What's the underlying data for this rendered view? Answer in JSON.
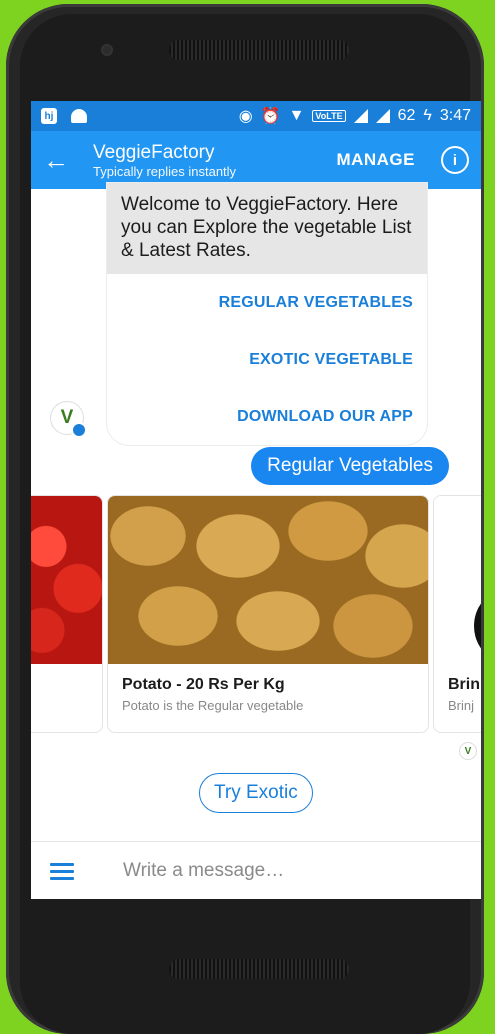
{
  "status_bar": {
    "app_icons": [
      "hj",
      "android-icon"
    ],
    "network": "VoLTE",
    "battery": "62",
    "time": "3:47"
  },
  "header": {
    "title": "VeggieFactory",
    "subtitle": "Typically replies instantly",
    "manage_label": "MANAGE",
    "info_label": "i"
  },
  "chat": {
    "card_text": "Welcome to VeggieFactory. Here you can Explore the vegetable List & Latest Rates.",
    "buttons": [
      "REGULAR VEGETABLES",
      "EXOTIC VEGETABLE",
      "DOWNLOAD OUR APP"
    ],
    "avatar_letter": "V",
    "user_message": "Regular Vegetables",
    "products": [
      {
        "title": "",
        "description": ""
      },
      {
        "title": "Potato - 20 Rs Per Kg",
        "description": "Potato is the Regular vegetable"
      },
      {
        "title": "Brin",
        "description": "Brinj"
      }
    ],
    "quick_reply": "Try Exotic"
  },
  "composer": {
    "placeholder": "Write a message…"
  },
  "colors": {
    "accent": "#2196f3",
    "status_bar": "#1a7fd9",
    "background": "#7ed321"
  }
}
